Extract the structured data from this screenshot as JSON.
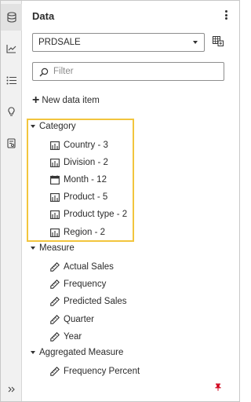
{
  "panel": {
    "title": "Data"
  },
  "datasource": {
    "selected": "PRDSALE"
  },
  "filter": {
    "placeholder": "Filter"
  },
  "new_item": {
    "label": "New data item"
  },
  "groups": [
    {
      "label": "Category",
      "items": [
        {
          "label": "Country - 3",
          "icon": "category-icon"
        },
        {
          "label": "Division - 2",
          "icon": "category-icon"
        },
        {
          "label": "Month - 12",
          "icon": "calendar-icon"
        },
        {
          "label": "Product - 5",
          "icon": "category-icon"
        },
        {
          "label": "Product type - 2",
          "icon": "category-icon"
        },
        {
          "label": "Region - 2",
          "icon": "category-icon"
        }
      ]
    },
    {
      "label": "Measure",
      "items": [
        {
          "label": "Actual Sales",
          "icon": "measure-icon"
        },
        {
          "label": "Frequency",
          "icon": "measure-icon"
        },
        {
          "label": "Predicted Sales",
          "icon": "measure-icon"
        },
        {
          "label": "Quarter",
          "icon": "measure-icon"
        },
        {
          "label": "Year",
          "icon": "measure-icon"
        }
      ]
    },
    {
      "label": "Aggregated Measure",
      "items": [
        {
          "label": "Frequency Percent",
          "icon": "measure-icon"
        }
      ]
    }
  ],
  "colors": {
    "highlight": "#f2c53d",
    "pin": "#d0021b"
  }
}
